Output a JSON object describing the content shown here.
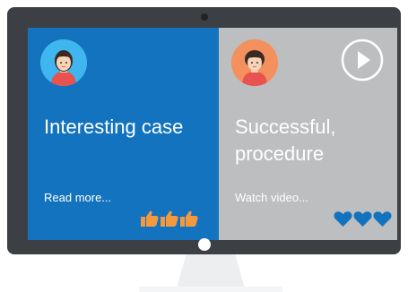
{
  "cards": [
    {
      "title": "Interesting case",
      "link": "Read more...",
      "reaction_icon": "thumbs-up-icon",
      "reaction_count": 3,
      "reaction_color": "#f5993f",
      "bg_color": "#1373bf"
    },
    {
      "title": "Successful, procedure",
      "link": "Watch video...",
      "reaction_icon": "heart-icon",
      "reaction_count": 3,
      "reaction_color": "#1373bf",
      "bg_color": "#bcbec0"
    }
  ]
}
